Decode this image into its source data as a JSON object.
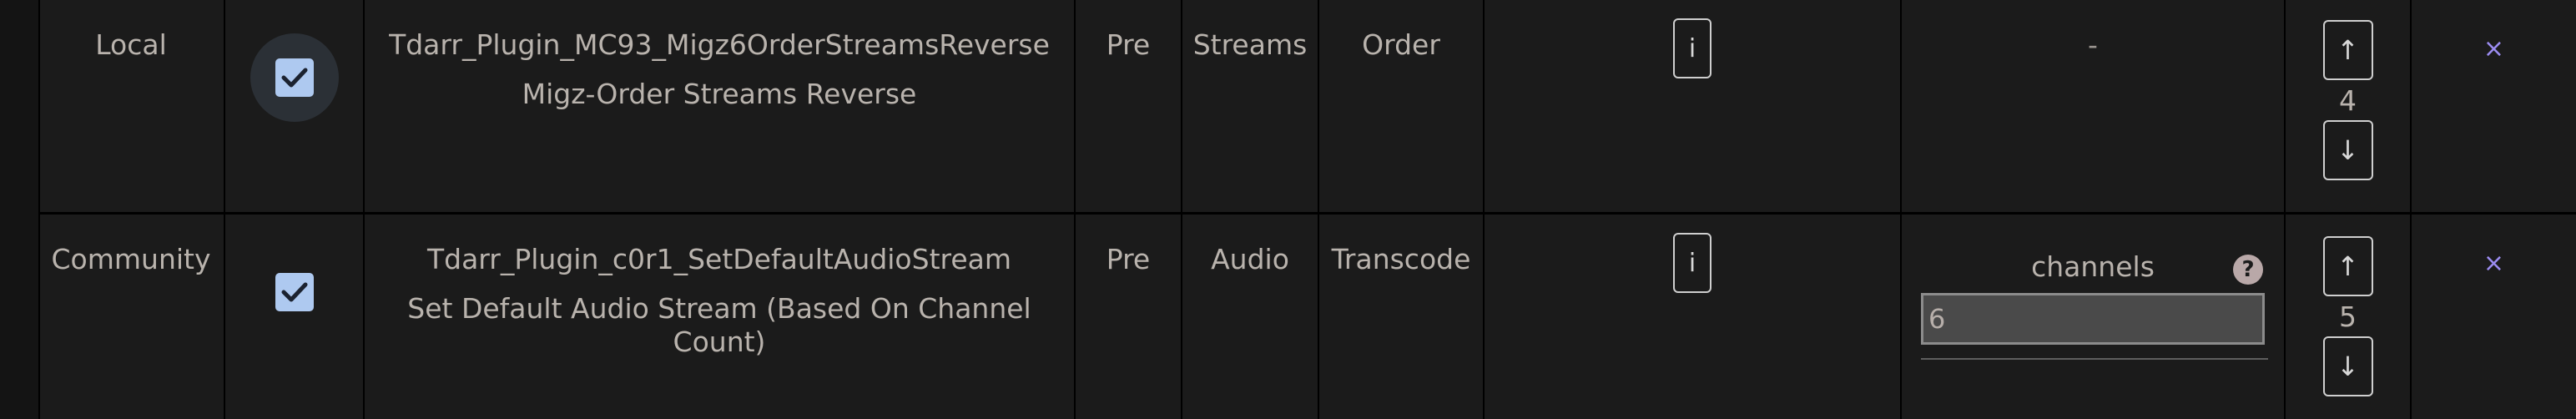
{
  "rows": [
    {
      "source": "Local",
      "checked": true,
      "plugin_id": "Tdarr_Plugin_MC93_Migz6OrderStreamsReverse",
      "plugin_name": "Migz-Order Streams Reverse",
      "stage": "Pre",
      "type": "Streams",
      "operation": "Order",
      "info_label": "i",
      "settings_placeholder": "-",
      "order": "4",
      "up_label": "↑",
      "down_label": "↓",
      "remove_label": "×"
    },
    {
      "source": "Community",
      "checked": true,
      "plugin_id": "Tdarr_Plugin_c0r1_SetDefaultAudioStream",
      "plugin_name": "Set Default Audio Stream (Based On Channel Count)",
      "stage": "Pre",
      "type": "Audio",
      "operation": "Transcode",
      "info_label": "i",
      "setting": {
        "label": "channels",
        "value": "6",
        "help_label": "?"
      },
      "order": "5",
      "up_label": "↑",
      "down_label": "↓",
      "remove_label": "×"
    }
  ],
  "colors": {
    "background": "#1b1b1b",
    "text": "#b9b3ad",
    "checkbox": "#aec9f0",
    "remove": "#9b8cf0"
  }
}
